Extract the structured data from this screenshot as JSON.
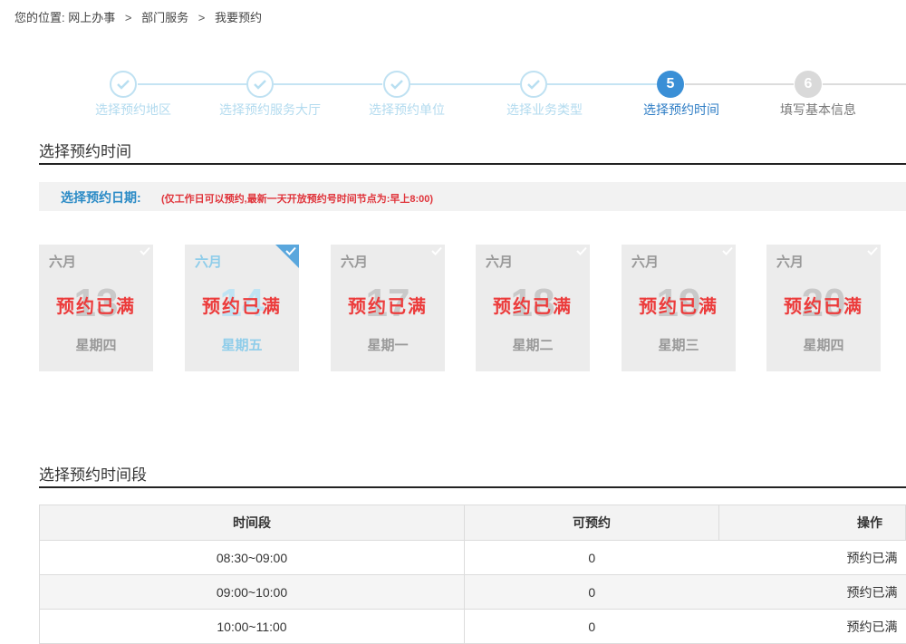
{
  "breadcrumb": {
    "prefix": "您的位置:",
    "items": [
      "网上办事",
      "部门服务",
      "我要预约"
    ],
    "separator": ">"
  },
  "steps": [
    {
      "label": "选择预约地区",
      "state": "done"
    },
    {
      "label": "选择预约服务大厅",
      "state": "done"
    },
    {
      "label": "选择预约单位",
      "state": "done"
    },
    {
      "label": "选择业务类型",
      "state": "done"
    },
    {
      "label": "选择预约时间",
      "state": "active",
      "number": "5"
    },
    {
      "label": "填写基本信息",
      "state": "todo",
      "number": "6"
    }
  ],
  "section_time": {
    "title": "选择预约时间"
  },
  "date_bar": {
    "label": "选择预约日期:",
    "note": "(仅工作日可以预约,最新一天开放预约号时间节点为:早上8:00)"
  },
  "days": [
    {
      "month": "六月",
      "day": "13",
      "weekday": "星期四",
      "status": "预约已满",
      "selected": false
    },
    {
      "month": "六月",
      "day": "14",
      "weekday": "星期五",
      "status": "预约已满",
      "selected": true
    },
    {
      "month": "六月",
      "day": "17",
      "weekday": "星期一",
      "status": "预约已满",
      "selected": false
    },
    {
      "month": "六月",
      "day": "18",
      "weekday": "星期二",
      "status": "预约已满",
      "selected": false
    },
    {
      "month": "六月",
      "day": "19",
      "weekday": "星期三",
      "status": "预约已满",
      "selected": false
    },
    {
      "month": "六月",
      "day": "20",
      "weekday": "星期四",
      "status": "预约已满",
      "selected": false
    }
  ],
  "section_slot": {
    "title": "选择预约时间段"
  },
  "slot_table": {
    "headers": [
      "时间段",
      "可预约",
      "操作"
    ],
    "rows": [
      {
        "time": "08:30~09:00",
        "available": "0",
        "action": "预约已满"
      },
      {
        "time": "09:00~10:00",
        "available": "0",
        "action": "预约已满"
      },
      {
        "time": "10:00~11:00",
        "available": "0",
        "action": "预约已满"
      }
    ]
  },
  "colors": {
    "accent_blue": "#3a8fd6",
    "done_blue": "#bfe1f2",
    "full_red": "#ec3b3b"
  },
  "icons": {
    "step_done": "check-icon",
    "day_corner": "check-icon"
  }
}
